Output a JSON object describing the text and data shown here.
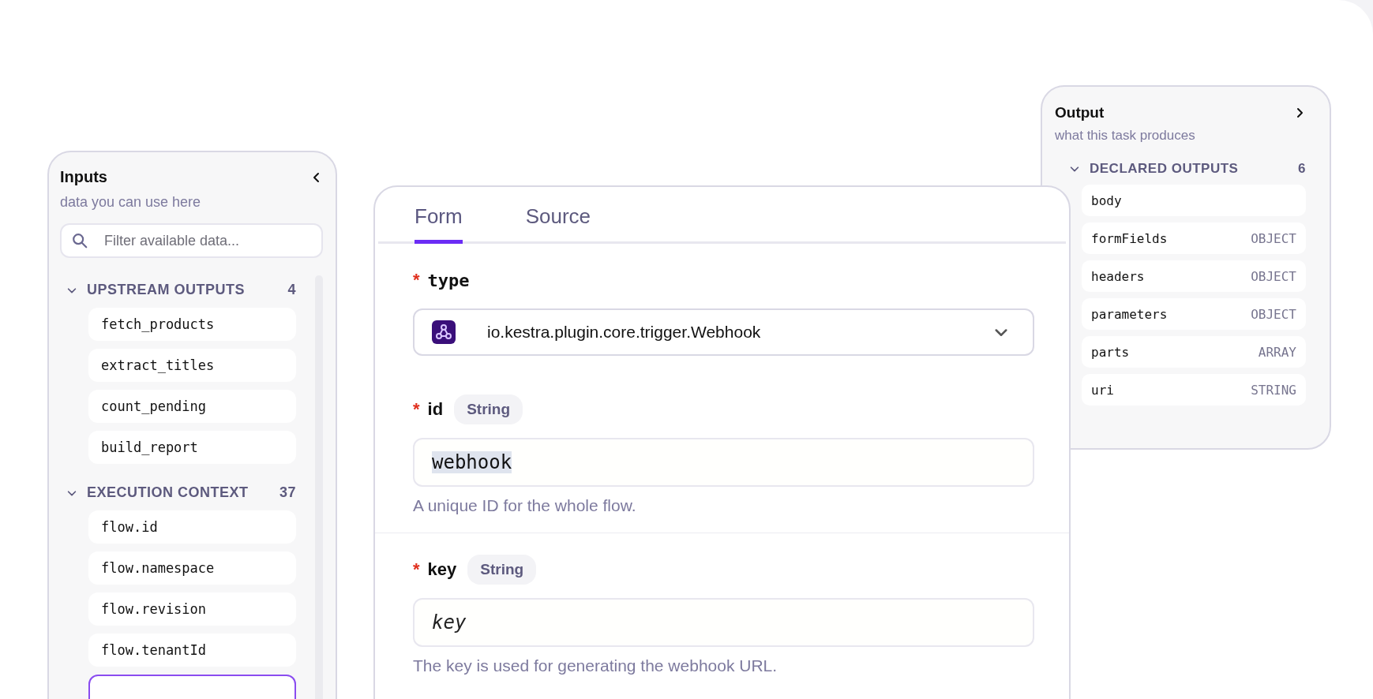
{
  "inputs_panel": {
    "title": "Inputs",
    "subtitle": "data you can use here",
    "search": {
      "placeholder": "Filter available data..."
    },
    "sections": [
      {
        "title": "UPSTREAM OUTPUTS",
        "count": "4",
        "expanded": true,
        "items": [
          {
            "label": "fetch_products",
            "selected": false
          },
          {
            "label": "extract_titles",
            "selected": false
          },
          {
            "label": "count_pending",
            "selected": false
          },
          {
            "label": "build_report",
            "selected": false
          }
        ]
      },
      {
        "title": "EXECUTION CONTEXT",
        "count": "37",
        "expanded": true,
        "items": [
          {
            "label": "flow.id",
            "selected": false
          },
          {
            "label": "flow.namespace",
            "selected": false
          },
          {
            "label": "flow.revision",
            "selected": false
          },
          {
            "label": "flow.tenantId",
            "selected": false
          },
          {
            "selected": true
          }
        ]
      }
    ]
  },
  "editor": {
    "tabs": [
      {
        "label": "Form",
        "selected": true
      },
      {
        "label": "Source",
        "selected": false
      }
    ],
    "fields": [
      {
        "kind": "select",
        "required_mark": "*",
        "label": "type",
        "value": "io.kestra.plugin.core.trigger.Webhook"
      },
      {
        "kind": "text",
        "required_mark": "*",
        "label": "id",
        "type_badge": "String",
        "value": "webhook",
        "help": "A unique ID for the whole flow."
      },
      {
        "kind": "text",
        "required_mark": "*",
        "label": "key",
        "type_badge": "String",
        "placeholder": "key",
        "help": "The key is used for generating the webhook URL."
      }
    ]
  },
  "output_panel": {
    "title": "Output",
    "subtitle": "what this task produces",
    "section": {
      "title": "DECLARED OUTPUTS",
      "count": "6",
      "expanded": true
    },
    "items": [
      {
        "name": "body"
      },
      {
        "name": "formFields",
        "type": "OBJECT"
      },
      {
        "name": "headers",
        "type": "OBJECT"
      },
      {
        "name": "parameters",
        "type": "OBJECT"
      },
      {
        "name": "parts",
        "type": "ARRAY"
      },
      {
        "name": "uri",
        "type": "STRING"
      }
    ]
  }
}
